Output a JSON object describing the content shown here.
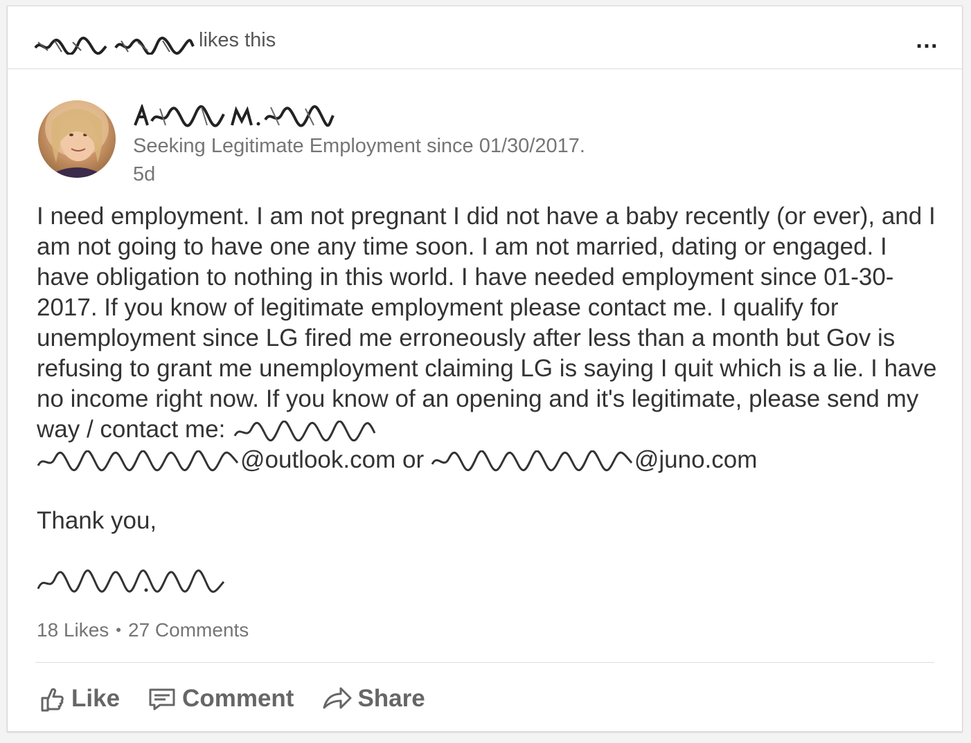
{
  "activity": {
    "suffix": "likes this",
    "more_label": "…"
  },
  "post": {
    "headline": "Seeking Legitimate Employment since 01/30/2017.",
    "time_ago": "5d",
    "body": {
      "para1_text": "I need employment. I am not pregnant I did not have a baby recently (or ever), and I am not going to have one any time soon. I am not married, dating or engaged. I have obligation to nothing in this world. I have needed employment since 01-30-2017. If you know of legitimate employment please contact me. I qualify for unemployment since LG fired me erroneously after less than a month but Gov is refusing to grant me unemployment claiming LG is saying I quit which is a lie. I have no income right now. If you know of an opening and it's legitimate, please send my way / contact me: ",
      "email1_domain": "@outlook.com",
      "or_text": " or ",
      "email2_domain": "@juno.com"
    },
    "closing": "Thank you,"
  },
  "social": {
    "likes": "18 Likes",
    "separator": "•",
    "comments": "27 Comments"
  },
  "actions": {
    "like": "Like",
    "comment": "Comment",
    "share": "Share"
  },
  "colors": {
    "text_primary": "#333333",
    "text_secondary": "#757575",
    "action_gray": "#666666",
    "divider": "#dcdcdc"
  }
}
